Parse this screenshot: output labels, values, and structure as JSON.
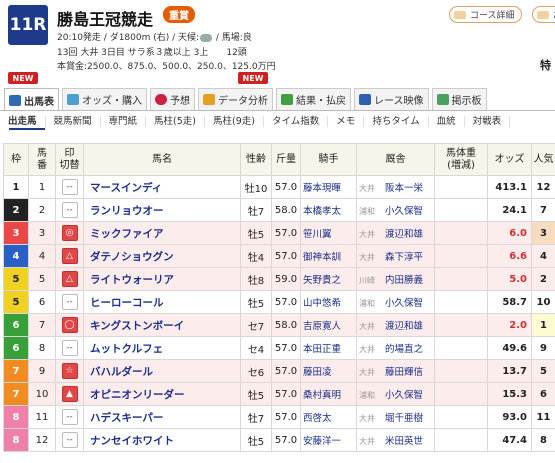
{
  "race": {
    "number": "11R",
    "name": "勝島王冠競走",
    "grade": "重賞",
    "line1": "20:10発走 / ダ1800m (右) / 天候:",
    "weather_icon": "cloud-icon",
    "line1b": " / 馬場:良",
    "line2": "13回 大井 3日目 サラ系３歳以上 3上　　12頭",
    "line3": "本賞金:2500.0、875.0、500.0、250.0、125.0万円",
    "special": "特"
  },
  "header_buttons": [
    {
      "label": "コース詳細"
    },
    {
      "label": "お"
    }
  ],
  "new_badge": "NEW",
  "tabs": [
    {
      "label": "出馬表",
      "color": "#2d6bb5"
    },
    {
      "label": "オッズ・購入",
      "color": "#4aa0d0"
    },
    {
      "label": "予想",
      "color": "#d02040"
    },
    {
      "label": "データ分析",
      "color": "#e8a020"
    },
    {
      "label": "結果・払戻",
      "color": "#40a040"
    },
    {
      "label": "レース映像",
      "color": "#3060b0"
    },
    {
      "label": "掲示板",
      "color": "#4aa060"
    }
  ],
  "subnav": [
    "出走馬",
    "競馬新聞",
    "専門紙",
    "馬柱(5走)",
    "馬柱(9走)",
    "タイム指数",
    "メモ",
    "持ちタイム",
    "血統",
    "対戦表"
  ],
  "columns": {
    "waku": "枠",
    "umaban": "馬\n番",
    "mark": "印\n切替",
    "horse": "馬名",
    "sexage": "性齢",
    "weight": "斤量",
    "jockey": "騎手",
    "trainer": "厩舎",
    "bw": "馬体重\n(増減)",
    "odds": "オッズ",
    "pop": "人気"
  },
  "rows": [
    {
      "waku": "1",
      "umaban": "1",
      "mark": "--",
      "horse": "マースインディ",
      "sexage": "牡10",
      "weight": "57.0",
      "jockey": "藤本現暉",
      "loc": "大井",
      "trainer": "阪本一栄",
      "odds": "413.1",
      "pop": "12"
    },
    {
      "waku": "2",
      "umaban": "2",
      "mark": "--",
      "horse": "ランリョウオー",
      "sexage": "牡7",
      "weight": "58.0",
      "jockey": "本橋孝太",
      "loc": "浦和",
      "trainer": "小久保智",
      "odds": "24.1",
      "pop": "7"
    },
    {
      "waku": "3",
      "umaban": "3",
      "mark": "◎",
      "horse": "ミックファイア",
      "sexage": "牡5",
      "weight": "57.0",
      "jockey": "笹川翼",
      "loc": "大井",
      "trainer": "渡辺和雄",
      "odds": "6.0",
      "pop": "3"
    },
    {
      "waku": "4",
      "umaban": "4",
      "mark": "△",
      "horse": "ダテノショウグン",
      "sexage": "牡4",
      "weight": "57.0",
      "jockey": "御神本訓",
      "loc": "大井",
      "trainer": "森下淳平",
      "odds": "6.6",
      "pop": "4"
    },
    {
      "waku": "5",
      "umaban": "5",
      "mark": "△",
      "horse": "ライトウォーリア",
      "sexage": "牡8",
      "weight": "59.0",
      "jockey": "矢野貴之",
      "loc": "川崎",
      "trainer": "内田勝義",
      "odds": "5.0",
      "pop": "2"
    },
    {
      "waku": "5",
      "umaban": "6",
      "mark": "--",
      "horse": "ヒーローコール",
      "sexage": "牡5",
      "weight": "57.0",
      "jockey": "山中悠希",
      "loc": "浦和",
      "trainer": "小久保智",
      "odds": "58.7",
      "pop": "10"
    },
    {
      "waku": "6",
      "umaban": "7",
      "mark": "◯",
      "horse": "キングストンボーイ",
      "sexage": "セ7",
      "weight": "58.0",
      "jockey": "吉原寛人",
      "loc": "大井",
      "trainer": "渡辺和雄",
      "odds": "2.0",
      "pop": "1"
    },
    {
      "waku": "6",
      "umaban": "8",
      "mark": "--",
      "horse": "ムットクルフェ",
      "sexage": "セ4",
      "weight": "57.0",
      "jockey": "本田正重",
      "loc": "大井",
      "trainer": "的場直之",
      "odds": "49.6",
      "pop": "9"
    },
    {
      "waku": "7",
      "umaban": "9",
      "mark": "☆",
      "horse": "バハルダール",
      "sexage": "セ6",
      "weight": "57.0",
      "jockey": "藤田凌",
      "loc": "大井",
      "trainer": "藤田輝信",
      "odds": "13.7",
      "pop": "5"
    },
    {
      "waku": "7",
      "umaban": "10",
      "mark": "▲",
      "horse": "オピニオンリーダー",
      "sexage": "牡5",
      "weight": "57.0",
      "jockey": "桑村真明",
      "loc": "浦和",
      "trainer": "小久保智",
      "odds": "15.3",
      "pop": "6"
    },
    {
      "waku": "8",
      "umaban": "11",
      "mark": "--",
      "horse": "ハデスキーパー",
      "sexage": "牡7",
      "weight": "57.0",
      "jockey": "西啓太",
      "loc": "大井",
      "trainer": "堀千亜樹",
      "odds": "93.0",
      "pop": "11"
    },
    {
      "waku": "8",
      "umaban": "12",
      "mark": "--",
      "horse": "ナンセイホワイト",
      "sexage": "牡5",
      "weight": "57.0",
      "jockey": "安藤洋一",
      "loc": "大井",
      "trainer": "米田英世",
      "odds": "47.4",
      "pop": "8"
    }
  ],
  "waku_colors": {
    "1": "#ffffff",
    "2": "#222222",
    "3": "#e84848",
    "4": "#2860c8",
    "5": "#f0d020",
    "6": "#38a038",
    "7": "#f08c20",
    "8": "#f080a8"
  }
}
